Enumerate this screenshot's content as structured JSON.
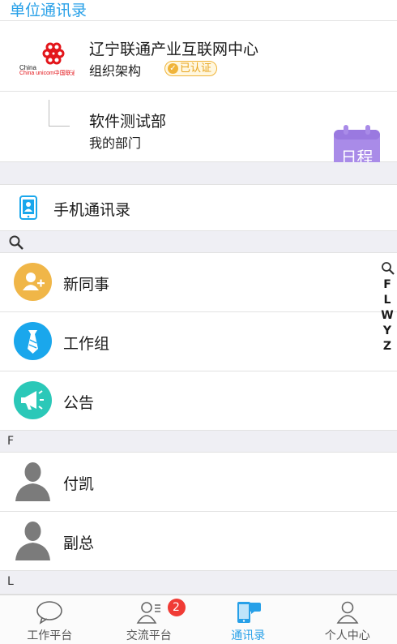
{
  "header": {
    "title": "单位通讯录"
  },
  "org": {
    "name": "辽宁联通产业互联网中心",
    "subtitle": "组织架构",
    "cert_label": "已认证",
    "logo_text": "China unicom中国联通"
  },
  "dept": {
    "name": "软件测试部",
    "subtitle": "我的部门"
  },
  "schedule_button": {
    "label": "日程"
  },
  "phone_contacts": {
    "label": "手机通讯录"
  },
  "entries": [
    {
      "label": "新同事",
      "icon": "add-user-icon",
      "color": "#f0b648"
    },
    {
      "label": "工作组",
      "icon": "tie-icon",
      "color": "#1aa7ec"
    },
    {
      "label": "公告",
      "icon": "megaphone-icon",
      "color": "#2bc8b8"
    }
  ],
  "letter_sections": [
    "F",
    "L"
  ],
  "contacts_f": [
    {
      "label": "付凯"
    },
    {
      "label": "副总"
    }
  ],
  "index_letters": [
    "F",
    "L",
    "W",
    "Y",
    "Z"
  ],
  "tabbar": {
    "tabs": [
      {
        "label": "工作平台",
        "icon": "chat-bubble-icon",
        "active": false
      },
      {
        "label": "交流平台",
        "icon": "contacts-list-icon",
        "active": false,
        "badge": "2"
      },
      {
        "label": "通讯录",
        "icon": "phone-contacts-icon",
        "active": true
      },
      {
        "label": "个人中心",
        "icon": "person-icon",
        "active": false
      }
    ]
  },
  "colors": {
    "accent": "#27a0e8",
    "badge": "#f03b35",
    "schedule": "#a98be8",
    "avatar": "#7b7b7b"
  }
}
